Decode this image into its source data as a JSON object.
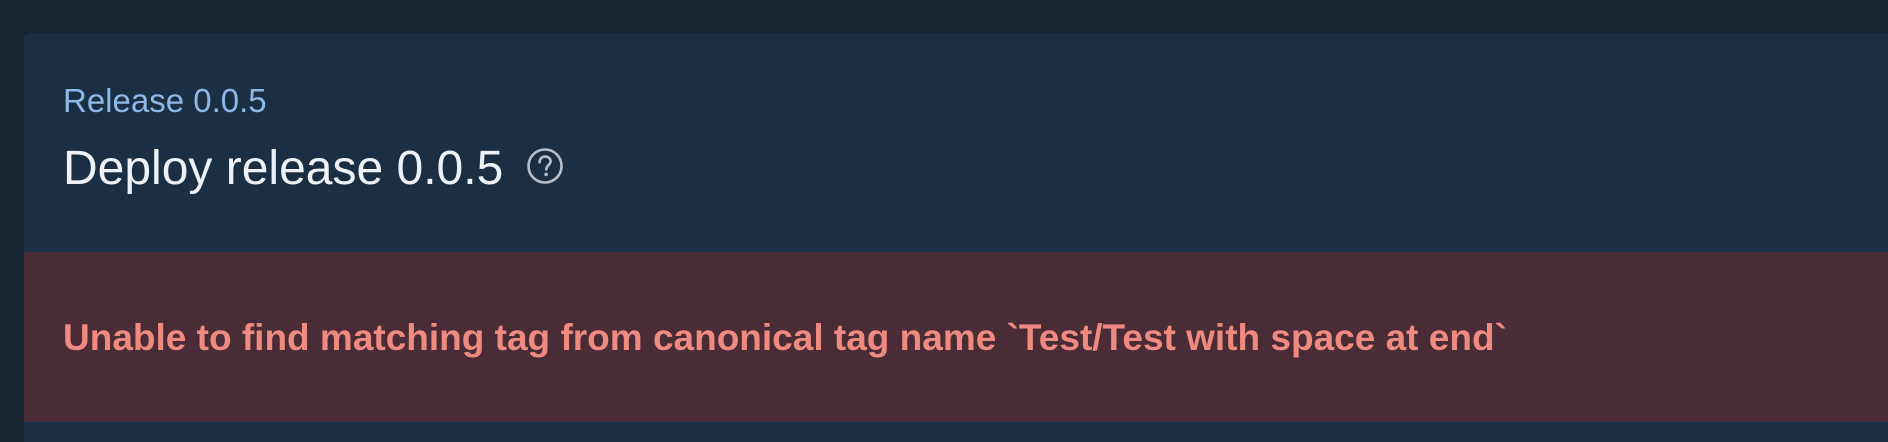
{
  "header": {
    "breadcrumb": "Release 0.0.5",
    "title": "Deploy release 0.0.5",
    "help_icon": "help-circle-icon"
  },
  "error": {
    "message": "Unable to find matching tag from canonical tag name `Test/Test with space at end`"
  },
  "colors": {
    "page_background": "#162433",
    "panel_background": "#1a2e44",
    "breadcrumb": "#8fb8e6",
    "title": "#eef2f6",
    "error_background": "#4a2c36",
    "error_text": "#ef8a80"
  }
}
